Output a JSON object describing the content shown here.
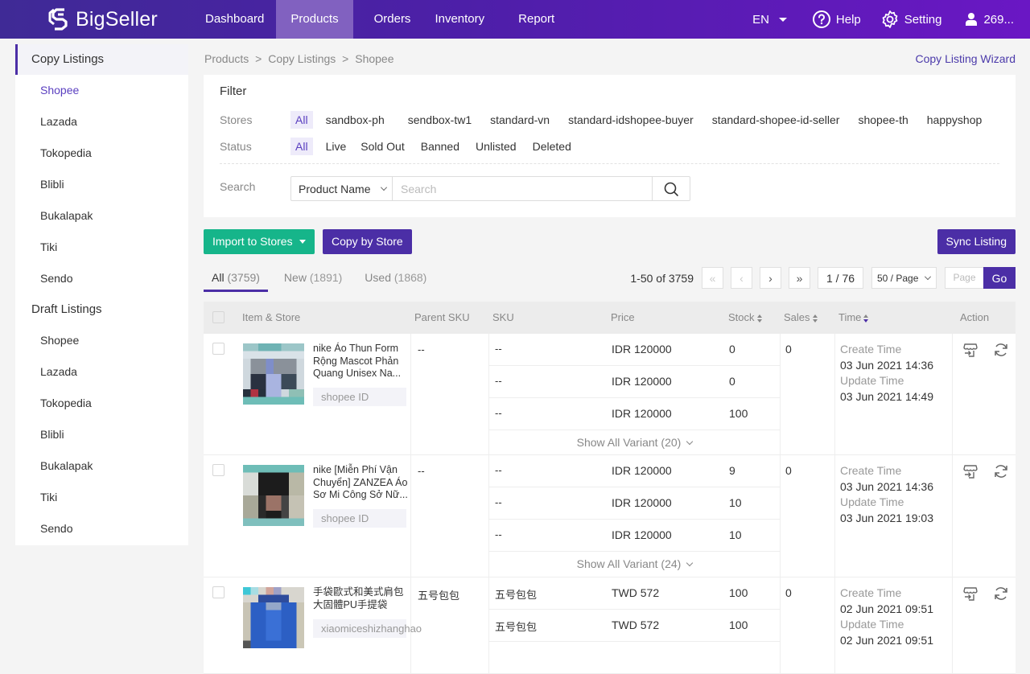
{
  "topbar": {
    "brand": "BigSeller",
    "nav": [
      "Dashboard",
      "Products",
      "Orders",
      "Inventory",
      "Report"
    ],
    "active_nav": "Products",
    "language": "EN",
    "help": "Help",
    "setting": "Setting",
    "user": "269..."
  },
  "sidebar": {
    "copy_title": "Copy Listings",
    "copy_items": [
      "Shopee",
      "Lazada",
      "Tokopedia",
      "Blibli",
      "Bukalapak",
      "Tiki",
      "Sendo"
    ],
    "draft_title": "Draft Listings",
    "draft_items": [
      "Shopee",
      "Lazada",
      "Tokopedia",
      "Blibli",
      "Bukalapak",
      "Tiki",
      "Sendo"
    ],
    "active": "Shopee"
  },
  "breadcrumb": {
    "items": [
      "Products",
      "Copy Listings",
      "Shopee"
    ],
    "separator": ">"
  },
  "wizard_link": "Copy Listing Wizard",
  "filter": {
    "title": "Filter",
    "stores_label": "Stores",
    "stores": [
      "All",
      "sandbox-ph",
      "sendbox-tw1",
      "standard-vn",
      "standard-idshopee-buyer",
      "standard-shopee-id-seller",
      "shopee-th",
      "happyshop"
    ],
    "status_label": "Status",
    "status": [
      "All",
      "Live",
      "Sold Out",
      "Banned",
      "Unlisted",
      "Deleted"
    ],
    "search_label": "Search",
    "search_field": "Product Name",
    "search_placeholder": "Search",
    "search_value": ""
  },
  "actions": {
    "import": "Import to Stores",
    "copy_by_store": "Copy by Store",
    "sync": "Sync Listing"
  },
  "tabs": [
    {
      "label": "All",
      "count": "(3759)",
      "active": true
    },
    {
      "label": "New",
      "count": "(1891)",
      "active": false
    },
    {
      "label": "Used",
      "count": "(1868)",
      "active": false
    }
  ],
  "pagination": {
    "range": "1-50 of 3759",
    "first": "«",
    "prev": "‹",
    "next": "›",
    "last": "»",
    "current": "1 / 76",
    "page_size": "50 / Page",
    "page_placeholder": "Page",
    "go": "Go"
  },
  "table": {
    "headers": {
      "item": "Item & Store",
      "parent_sku": "Parent SKU",
      "sku": "SKU",
      "price": "Price",
      "stock": "Stock",
      "sales": "Sales",
      "time": "Time",
      "action": "Action"
    },
    "create_label": "Create Time",
    "update_label": "Update Time",
    "rows": [
      {
        "name": "nike Áo Thun Form Rộng Mascot Phản Quang Unisex Na...",
        "store": "shopee ID",
        "parent_sku": "--",
        "variants": [
          {
            "sku": "--",
            "price": "IDR  120000",
            "stock": "0"
          },
          {
            "sku": "--",
            "price": "IDR  120000",
            "stock": "0"
          },
          {
            "sku": "--",
            "price": "IDR  120000",
            "stock": "100"
          }
        ],
        "show_all": "Show All Variant (20)",
        "sales": "0",
        "create_time": "03 Jun 2021 14:36",
        "update_time": "03 Jun 2021 14:49"
      },
      {
        "name": "nike [Miễn Phí Vận Chuyển] ZANZEA Áo Sơ Mi Công Sở Nữ...",
        "store": "shopee ID",
        "parent_sku": "--",
        "variants": [
          {
            "sku": "--",
            "price": "IDR  120000",
            "stock": "9"
          },
          {
            "sku": "--",
            "price": "IDR  120000",
            "stock": "10"
          },
          {
            "sku": "--",
            "price": "IDR  120000",
            "stock": "10"
          }
        ],
        "show_all": "Show All Variant (24)",
        "sales": "0",
        "create_time": "03 Jun 2021 14:36",
        "update_time": "03 Jun 2021 19:03"
      },
      {
        "name": "手袋歐式和美式肩包大固體PU手提袋",
        "store": "xiaomiceshizhanghao",
        "parent_sku": "五号包包",
        "variants": [
          {
            "sku": "五号包包",
            "price": "TWD  572",
            "stock": "100"
          },
          {
            "sku": "五号包包",
            "price": "TWD  572",
            "stock": "100"
          }
        ],
        "show_all": "",
        "sales": "0",
        "create_time": "02 Jun 2021 09:51",
        "update_time": "02 Jun 2021 09:51"
      }
    ]
  },
  "colors": {
    "brand_purple": "#4b2ea6",
    "import_green": "#16b58a",
    "active_nav_bg": "#8161c0"
  }
}
